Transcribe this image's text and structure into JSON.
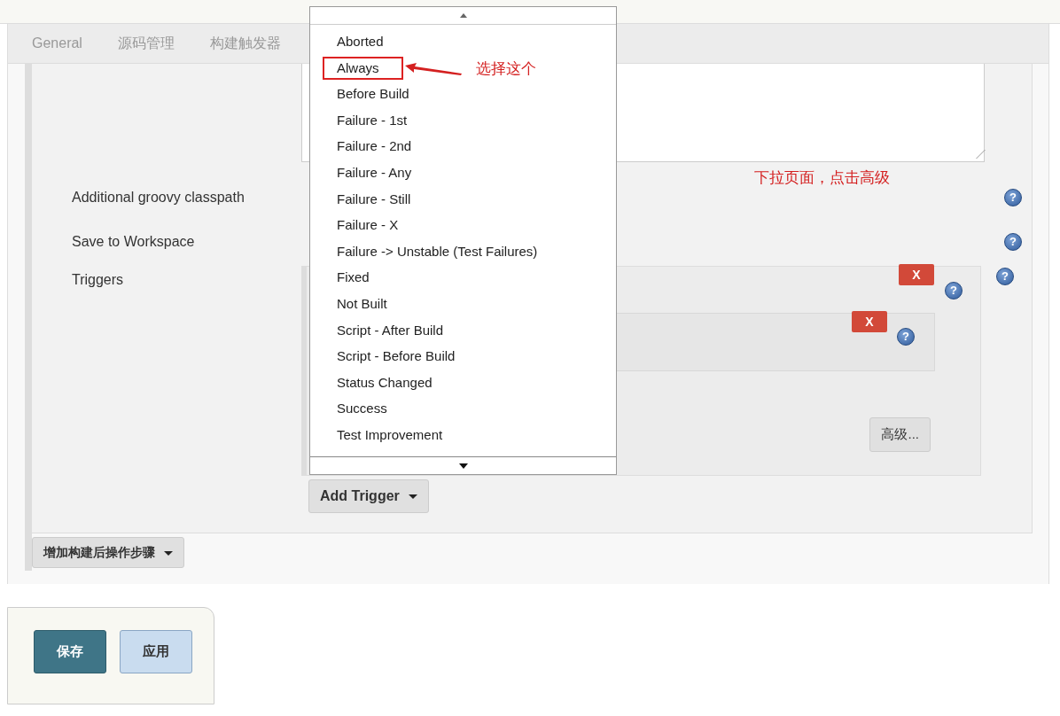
{
  "tabs": [
    {
      "label": "General"
    },
    {
      "label": "源码管理"
    },
    {
      "label": "构建触发器"
    }
  ],
  "fields": [
    {
      "kind": "textarea"
    },
    {
      "kind": "text",
      "label": "Additional groovy classpath",
      "help": "?"
    },
    {
      "kind": "checkbox",
      "label": "Save to Workspace",
      "help": "?"
    },
    {
      "kind": "triggers",
      "label": "Triggers",
      "help": "?"
    }
  ],
  "triggers": {
    "remove": "X",
    "help": "?",
    "inner": {
      "remove": "X",
      "help": "?"
    },
    "advanced_button": "高级...",
    "add_button": "Add Trigger"
  },
  "add_post_build_button": "增加构建后操作步骤",
  "buttons": [
    {
      "label": "保存",
      "kind": "primary"
    },
    {
      "label": "应用",
      "kind": "secondary"
    }
  ],
  "dropdown": {
    "options": [
      {
        "label": "Aborted",
        "marked": false
      },
      {
        "label": "Always",
        "marked": true
      },
      {
        "label": "Before Build",
        "marked": false
      },
      {
        "label": "Failure - 1st",
        "marked": false
      },
      {
        "label": "Failure - 2nd",
        "marked": false
      },
      {
        "label": "Failure - Any",
        "marked": false
      },
      {
        "label": "Failure - Still",
        "marked": false
      },
      {
        "label": "Failure - X",
        "marked": false
      },
      {
        "label": "Failure -> Unstable (Test Failures)",
        "marked": false
      },
      {
        "label": "Fixed",
        "marked": false
      },
      {
        "label": "Not Built",
        "marked": false
      },
      {
        "label": "Script - After Build",
        "marked": false
      },
      {
        "label": "Script - Before Build",
        "marked": false
      },
      {
        "label": "Status Changed",
        "marked": false
      },
      {
        "label": "Success",
        "marked": false
      },
      {
        "label": "Test Improvement",
        "marked": false
      }
    ]
  },
  "annotations": [
    {
      "kind": "callout",
      "text": "选择这个"
    },
    {
      "kind": "note",
      "text": "下拉页面，点击高级"
    }
  ]
}
